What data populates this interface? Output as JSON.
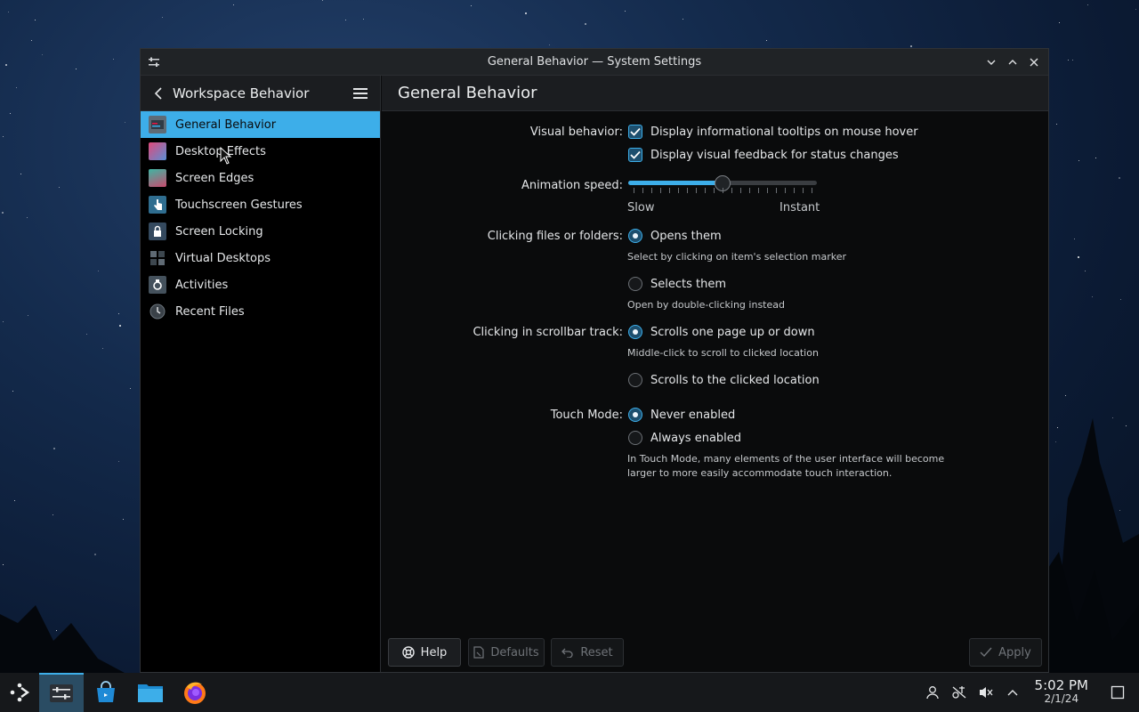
{
  "window": {
    "title": "General Behavior — System Settings"
  },
  "sidebar": {
    "title": "Workspace Behavior",
    "items": [
      {
        "label": "General Behavior",
        "icon": "general-behavior-icon",
        "active": true
      },
      {
        "label": "Desktop Effects",
        "icon": "desktop-effects-icon"
      },
      {
        "label": "Screen Edges",
        "icon": "screen-edges-icon"
      },
      {
        "label": "Touchscreen Gestures",
        "icon": "touchscreen-gestures-icon"
      },
      {
        "label": "Screen Locking",
        "icon": "screen-locking-icon"
      },
      {
        "label": "Virtual Desktops",
        "icon": "virtual-desktops-icon"
      },
      {
        "label": "Activities",
        "icon": "activities-icon"
      },
      {
        "label": "Recent Files",
        "icon": "recent-files-icon"
      }
    ]
  },
  "main": {
    "title": "General Behavior",
    "visual_behavior": {
      "label": "Visual behavior:",
      "tooltips": {
        "label": "Display informational tooltips on mouse hover",
        "checked": true
      },
      "feedback": {
        "label": "Display visual feedback for status changes",
        "checked": true
      }
    },
    "animation_speed": {
      "label": "Animation speed:",
      "min_label": "Slow",
      "max_label": "Instant",
      "value_fraction": 0.5
    },
    "clicking_files": {
      "label": "Clicking files or folders:",
      "opens": {
        "label": "Opens them",
        "hint": "Select by clicking on item's selection marker",
        "selected": true
      },
      "selects": {
        "label": "Selects them",
        "hint": "Open by double-clicking instead",
        "selected": false
      }
    },
    "scrollbar": {
      "label": "Clicking in scrollbar track:",
      "page": {
        "label": "Scrolls one page up or down",
        "hint": "Middle-click to scroll to clicked location",
        "selected": true
      },
      "location": {
        "label": "Scrolls to the clicked location",
        "selected": false
      }
    },
    "touch_mode": {
      "label": "Touch Mode:",
      "never": {
        "label": "Never enabled",
        "selected": true
      },
      "always": {
        "label": "Always enabled",
        "selected": false
      },
      "hint_line1": "In Touch Mode, many elements of the user interface will become",
      "hint_line2": "larger to more easily accommodate touch interaction."
    },
    "buttons": {
      "help": "Help",
      "defaults": "Defaults",
      "reset": "Reset",
      "apply": "Apply"
    }
  },
  "taskbar": {
    "time": "5:02 PM",
    "date": "2/1/24"
  },
  "colors": {
    "accent": "#3daee9",
    "window_bg": "#0a0b0c",
    "header_bg": "#1b1d20"
  }
}
